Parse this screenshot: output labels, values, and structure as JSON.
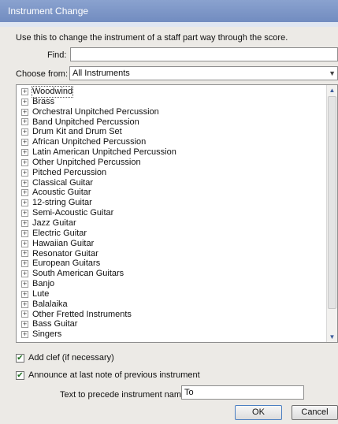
{
  "window": {
    "title": "Instrument Change"
  },
  "description": "Use this to change the instrument of a staff part way through the score.",
  "find": {
    "label": "Find:",
    "value": ""
  },
  "choose_from": {
    "label": "Choose from:",
    "selected": "All Instruments"
  },
  "instrument_tree": {
    "items": [
      {
        "label": "Woodwind",
        "expander": "+"
      },
      {
        "label": "Brass",
        "expander": "+"
      },
      {
        "label": "Orchestral Unpitched Percussion",
        "expander": "+"
      },
      {
        "label": "Band Unpitched Percussion",
        "expander": "+"
      },
      {
        "label": "Drum Kit and Drum Set",
        "expander": "+"
      },
      {
        "label": "African Unpitched Percussion",
        "expander": "+"
      },
      {
        "label": "Latin American Unpitched Percussion",
        "expander": "+"
      },
      {
        "label": "Other Unpitched Percussion",
        "expander": "+"
      },
      {
        "label": "Pitched Percussion",
        "expander": "+"
      },
      {
        "label": "Classical Guitar",
        "expander": "+"
      },
      {
        "label": "Acoustic Guitar",
        "expander": "+"
      },
      {
        "label": "12-string Guitar",
        "expander": "+"
      },
      {
        "label": "Semi-Acoustic Guitar",
        "expander": "+"
      },
      {
        "label": "Jazz Guitar",
        "expander": "+"
      },
      {
        "label": "Electric Guitar",
        "expander": "+"
      },
      {
        "label": "Hawaiian Guitar",
        "expander": "+"
      },
      {
        "label": "Resonator Guitar",
        "expander": "+"
      },
      {
        "label": "European Guitars",
        "expander": "+"
      },
      {
        "label": "South American Guitars",
        "expander": "+"
      },
      {
        "label": "Banjo",
        "expander": "+"
      },
      {
        "label": "Lute",
        "expander": "+"
      },
      {
        "label": "Balalaika",
        "expander": "+"
      },
      {
        "label": "Other Fretted Instruments",
        "expander": "+"
      },
      {
        "label": "Bass Guitar",
        "expander": "+"
      },
      {
        "label": "Singers",
        "expander": "+"
      }
    ],
    "focused_index": 0,
    "scroll_up_glyph": "▲",
    "scroll_down_glyph": "▼"
  },
  "options": {
    "add_clef": {
      "label": "Add clef (if necessary)",
      "checked": true,
      "mark": "✔"
    },
    "announce": {
      "label": "Announce at last note of previous instrument",
      "checked": true,
      "mark": "✔"
    }
  },
  "prefix": {
    "label": "Text to precede instrument name:",
    "value": "To"
  },
  "buttons": {
    "ok": "OK",
    "cancel": "Cancel"
  },
  "icons": {
    "select_arrow": "chevron-down-icon",
    "tree_expander": "plus-box-icon",
    "checkmark": "checkmark-icon"
  },
  "colors": {
    "titlebar": "#7b93c6",
    "ok_border": "#4b7fc1"
  }
}
